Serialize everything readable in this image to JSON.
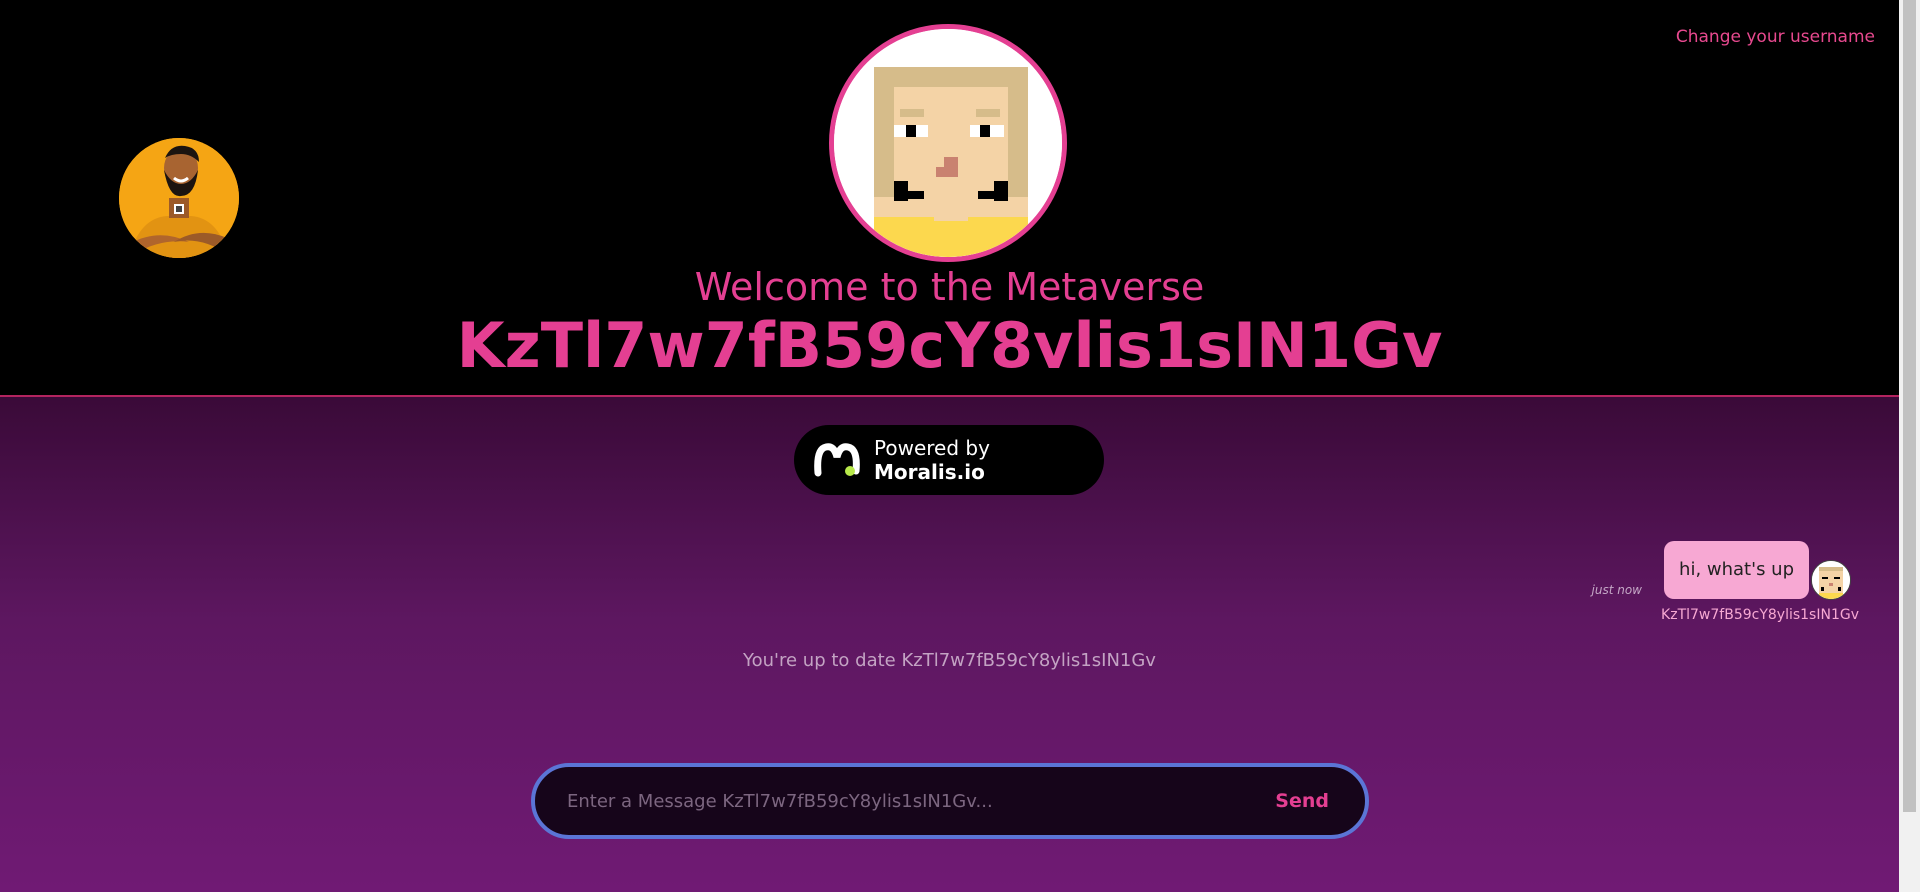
{
  "header": {
    "change_username_label": "Change your username",
    "welcome_text": "Welcome to the Metaverse",
    "username": "KzTl7w7fB59cY8ylis1sIN1Gv"
  },
  "badge": {
    "prefix": "Powered by ",
    "brand": "Moralis.io"
  },
  "messages": [
    {
      "time": "just now",
      "text": "hi, what's up",
      "author": "KzTl7w7fB59cY8ylis1sIN1Gv"
    }
  ],
  "status": {
    "up_to_date": "You're up to date KzTl7w7fB59cY8ylis1sIN1Gv"
  },
  "composer": {
    "placeholder": "Enter a Message KzTl7w7fB59cY8ylis1sIN1Gv...",
    "value": "",
    "send_label": "Send"
  },
  "colors": {
    "accent": "#e43f92",
    "bubble": "#f7a8d3",
    "input_border": "#5b75d6",
    "side_avatar_bg": "#f5a514"
  },
  "icons": {
    "side_avatar": "cartoon-man-avatar",
    "main_avatar": "pixel-face-avatar",
    "moralis_logo": "moralis-logo-icon"
  }
}
